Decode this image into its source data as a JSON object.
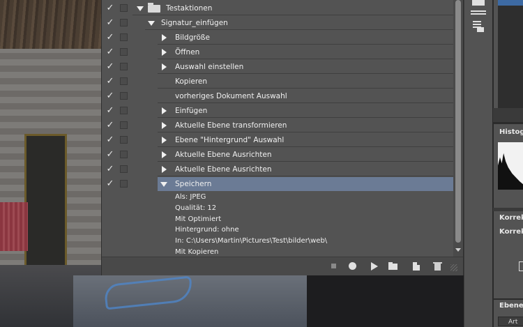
{
  "actions_panel": {
    "set_name": "Testaktionen",
    "action_name": "Signatur_einfügen",
    "steps": [
      {
        "label": "Bildgröße",
        "expandable": true
      },
      {
        "label": "Öffnen",
        "expandable": true
      },
      {
        "label": "Auswahl einstellen",
        "expandable": true
      },
      {
        "label": "Kopieren",
        "expandable": false
      },
      {
        "label": "vorheriges Dokument Auswahl",
        "expandable": false
      },
      {
        "label": "Einfügen",
        "expandable": true
      },
      {
        "label": "Aktuelle Ebene transformieren",
        "expandable": true
      },
      {
        "label": "Ebene \"Hintergrund\" Auswahl",
        "expandable": true
      },
      {
        "label": "Aktuelle Ebene Ausrichten",
        "expandable": true
      },
      {
        "label": "Aktuelle Ebene Ausrichten",
        "expandable": true
      },
      {
        "label": "Speichern",
        "expandable": true,
        "expanded": true,
        "selected": true
      }
    ],
    "save_details": [
      "Als: JPEG",
      "Qualität: 12",
      "Mit Optimiert",
      "Hintergrund: ohne",
      "In: C:\\Users\\Martin\\Pictures\\Test\\bilder\\web\\",
      "Mit Kopieren"
    ],
    "check_glyph": "✓",
    "footer_icons": [
      "stop-icon",
      "record-icon",
      "play-icon",
      "new-set-icon",
      "new-action-icon",
      "trash-icon"
    ]
  },
  "right_panels": {
    "histogram_title": "Histogr",
    "corrections_title": "Korrekt",
    "corrections_subtitle": "Korrek",
    "layers_title": "Ebenen",
    "layers_search": "Art"
  },
  "colors": {
    "panel_bg": "#535353",
    "selection": "#6b7b95",
    "text": "#f0f0f0"
  }
}
